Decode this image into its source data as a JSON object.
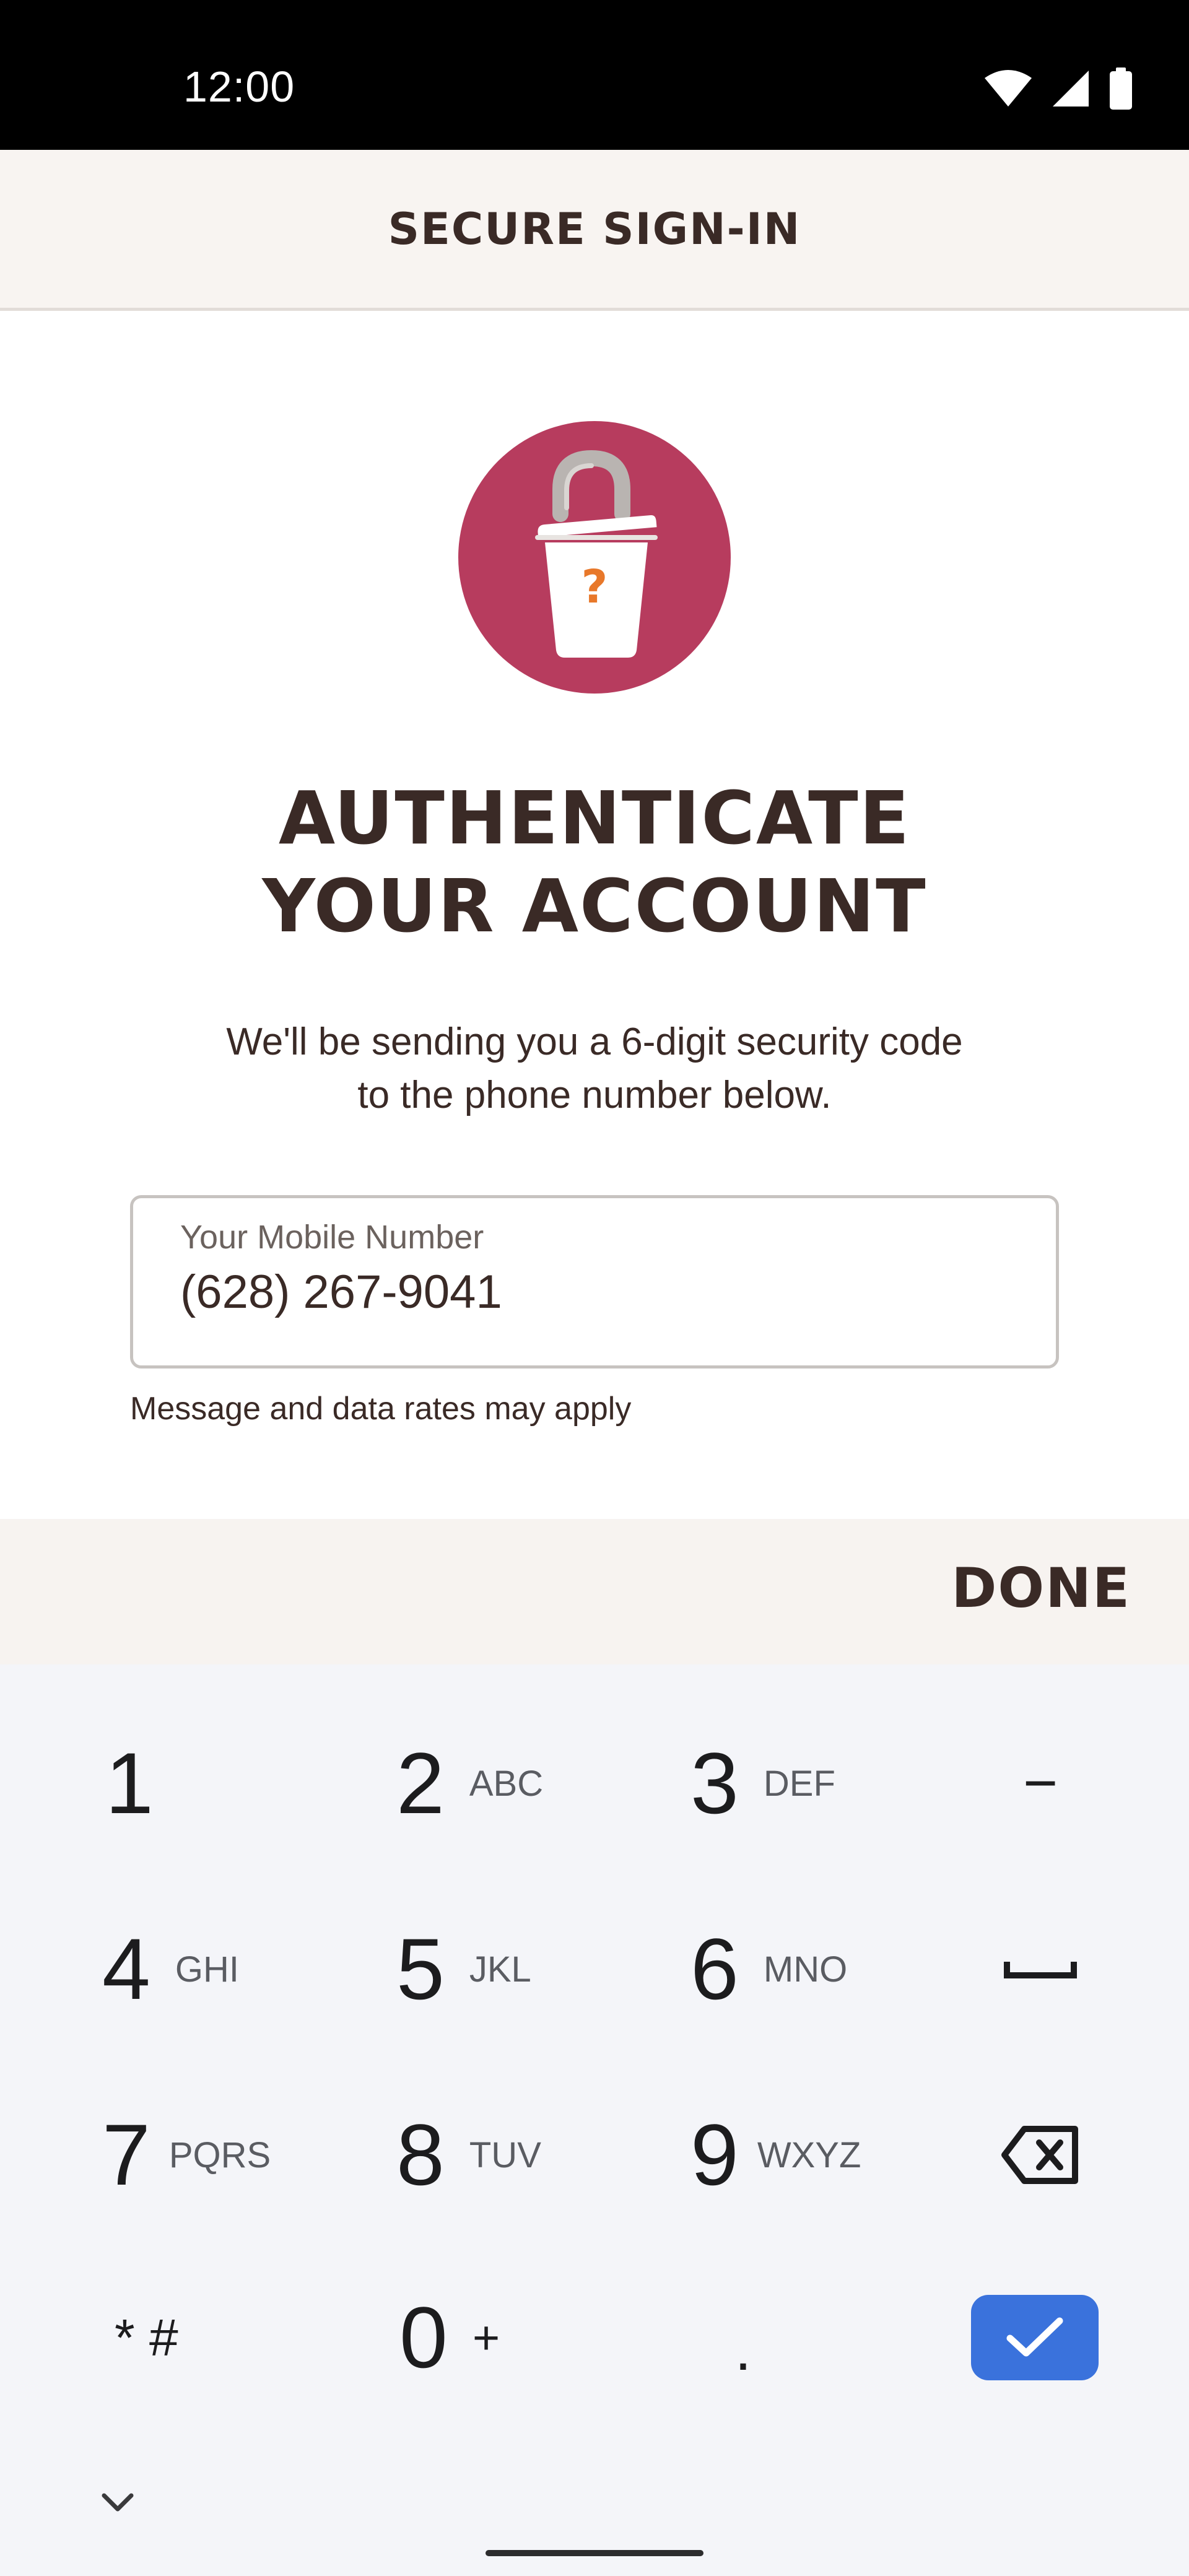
{
  "status_bar": {
    "time": "12:00",
    "icons": [
      "wifi-icon",
      "cellular-signal-icon",
      "battery-icon"
    ]
  },
  "header": {
    "title": "SECURE SIGN-IN"
  },
  "badge": {
    "icon": "lock-cup-icon",
    "glyph": "?",
    "colors": {
      "circle": "#b73c5e",
      "question_mark": "#e8782a"
    }
  },
  "main": {
    "headline_line1": "AUTHENTICATE",
    "headline_line2": "YOUR ACCOUNT",
    "description_line1": "We'll be sending you a 6-digit security code",
    "description_line2": "to the phone number below."
  },
  "phone_field": {
    "label": "Your Mobile Number",
    "value": "(628) 267-9041"
  },
  "disclaimer": "Message and data rates may apply",
  "done_bar": {
    "done_label": "DONE"
  },
  "keyboard": {
    "keys": [
      {
        "num": "1",
        "letters": ""
      },
      {
        "num": "2",
        "letters": "ABC"
      },
      {
        "num": "3",
        "letters": "DEF"
      },
      {
        "num": "4",
        "letters": "GHI"
      },
      {
        "num": "5",
        "letters": "JKL"
      },
      {
        "num": "6",
        "letters": "MNO"
      },
      {
        "num": "7",
        "letters": "PQRS"
      },
      {
        "num": "8",
        "letters": "TUV"
      },
      {
        "num": "9",
        "letters": "WXYZ"
      },
      {
        "num": "0",
        "letters": "+"
      }
    ],
    "star_hash": "* #",
    "dot": ".",
    "dash": "−",
    "enter_color": "#3a72dc"
  }
}
